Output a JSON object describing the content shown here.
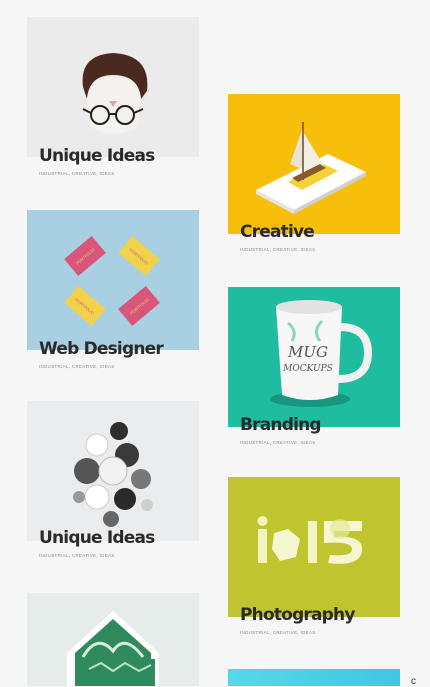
{
  "cards": [
    {
      "title": "Unique Ideas",
      "tags": "INDUSTRIAL, CREATIVE, IDEAS",
      "image_icon": "face-glasses-illustration",
      "bg": "#e9e9e9"
    },
    {
      "title": "Creative",
      "tags": "INDUSTRIAL, CREATIVE, IDEAS",
      "image_icon": "phone-boat-illustration",
      "bg": "#f7bf0c"
    },
    {
      "title": "Web Designer",
      "tags": "INDUSTRIAL, CREATIVE, IDEAS",
      "image_icon": "business-cards-illustration",
      "bg": "#a9cfe3"
    },
    {
      "title": "Branding",
      "tags": "INDUSTRIAL, CREATIVE, IDEAS",
      "image_icon": "mug-mockup-illustration",
      "bg": "#1fbc9f"
    },
    {
      "title": "Unique Ideas",
      "tags": "INDUSTRIAL, CREATIVE, IDEAS",
      "image_icon": "spheres-illustration",
      "bg": "#e9eced"
    },
    {
      "title": "Photography",
      "tags": "INDUSTRIAL, CREATIVE, IDEAS",
      "image_icon": "io15-logo-illustration",
      "bg": "#c0c52f"
    },
    {
      "title": "",
      "tags": "",
      "image_icon": "envelope-leaves-illustration",
      "bg": "#e6ecea"
    },
    {
      "title": "",
      "tags": "",
      "image_icon": "cyan-image",
      "bg": "#4fd3e6"
    }
  ],
  "mug_text": {
    "line1": "MUG",
    "line2": "MOCKUPS"
  },
  "badge_text": "PORTFOLIO",
  "logo_text": "io15",
  "corner_text": "c"
}
